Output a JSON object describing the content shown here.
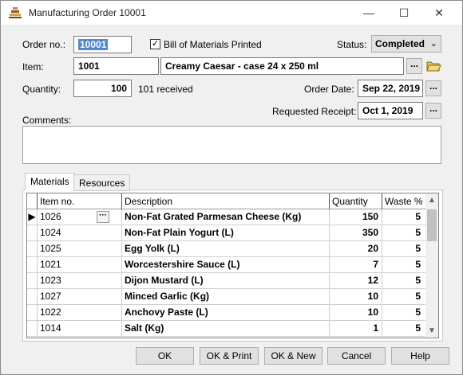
{
  "window": {
    "title": "Manufacturing Order 10001",
    "minimize": "—",
    "maximize": "☐",
    "close": "✕"
  },
  "form": {
    "order_no_label": "Order no.:",
    "order_no_value": "10001",
    "bom_label": "Bill of Materials Printed",
    "bom_checked": "✓",
    "status_label": "Status:",
    "status_value": "Completed",
    "item_label": "Item:",
    "item_code": "1001",
    "item_description": "Creamy Caesar - case 24 x 250 ml",
    "quantity_label": "Quantity:",
    "quantity_value": "100",
    "received_text": "101 received",
    "order_date_label": "Order Date:",
    "order_date_value": "Sep 22, 2019",
    "requested_receipt_label": "Requested Receipt:",
    "requested_receipt_value": "Oct 1, 2019",
    "comments_label": "Comments:",
    "comments_value": "",
    "ellipsis": "..."
  },
  "tabs": [
    {
      "label": "Materials",
      "active": true
    },
    {
      "label": "Resources",
      "active": false
    }
  ],
  "grid": {
    "columns": [
      "Item no.",
      "Description",
      "Quantity",
      "Waste %"
    ],
    "current_row_marker": "▶",
    "row_button": "···",
    "rows": [
      {
        "item": "1026",
        "description": "Non-Fat Grated Parmesan Cheese (Kg)",
        "quantity": "150",
        "waste": "5"
      },
      {
        "item": "1024",
        "description": "Non-Fat Plain Yogurt (L)",
        "quantity": "350",
        "waste": "5"
      },
      {
        "item": "1025",
        "description": "Egg Yolk (L)",
        "quantity": "20",
        "waste": "5"
      },
      {
        "item": "1021",
        "description": "Worcestershire Sauce (L)",
        "quantity": "7",
        "waste": "5"
      },
      {
        "item": "1023",
        "description": "Dijon Mustard (L)",
        "quantity": "12",
        "waste": "5"
      },
      {
        "item": "1027",
        "description": "Minced Garlic (Kg)",
        "quantity": "10",
        "waste": "5"
      },
      {
        "item": "1022",
        "description": "Anchovy Paste (L)",
        "quantity": "10",
        "waste": "5"
      },
      {
        "item": "1014",
        "description": "Salt (Kg)",
        "quantity": "1",
        "waste": "5"
      }
    ]
  },
  "buttons": {
    "ok": "OK",
    "ok_print": "OK & Print",
    "ok_new": "OK & New",
    "cancel": "Cancel",
    "help": "Help"
  },
  "colors": {
    "selection": "#4f86d6",
    "window_bg": "#f0f0f0"
  },
  "icons": {
    "app": "app-stack-icon",
    "folder": "folder-open-icon"
  }
}
